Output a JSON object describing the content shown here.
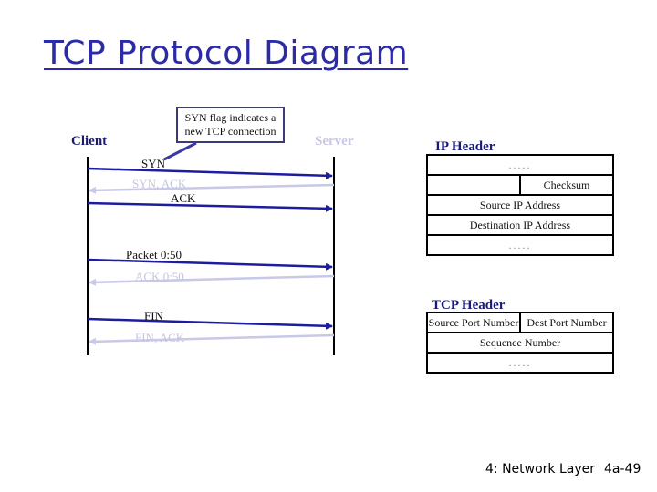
{
  "title": "TCP Protocol Diagram",
  "sequence": {
    "client_label": "Client",
    "server_label": "Server",
    "callout": {
      "line1": "SYN flag indicates a",
      "line2": "new TCP connection"
    },
    "messages": [
      {
        "label": "SYN",
        "direction": "client-to-server"
      },
      {
        "label": "SYN, ACK",
        "direction": "server-to-client"
      },
      {
        "label": "ACK",
        "direction": "client-to-server"
      },
      {
        "label": "Packet 0:50",
        "direction": "client-to-server"
      },
      {
        "label": "ACK 0:50",
        "direction": "server-to-client"
      },
      {
        "label": "FIN",
        "direction": "client-to-server"
      },
      {
        "label": "FIN, ACK",
        "direction": "server-to-client"
      }
    ],
    "colors": {
      "forward": "#1c1ca0",
      "reverse": "#c8c8e8",
      "lifeline": "#000000"
    }
  },
  "ip_header": {
    "title": "IP Header",
    "rows": [
      {
        "cells": [
          "....."
        ]
      },
      {
        "cells": [
          "",
          "Checksum"
        ]
      },
      {
        "cells": [
          "Source IP Address"
        ]
      },
      {
        "cells": [
          "Destination IP Address"
        ]
      },
      {
        "cells": [
          "....."
        ]
      }
    ]
  },
  "tcp_header": {
    "title": "TCP Header",
    "rows": [
      {
        "cells": [
          "Source Port Number",
          "Dest Port Number"
        ]
      },
      {
        "cells": [
          "Sequence Number"
        ]
      },
      {
        "cells": [
          "....."
        ]
      }
    ]
  },
  "footer": {
    "chapter": "4: Network Layer",
    "page": "4a-49"
  }
}
